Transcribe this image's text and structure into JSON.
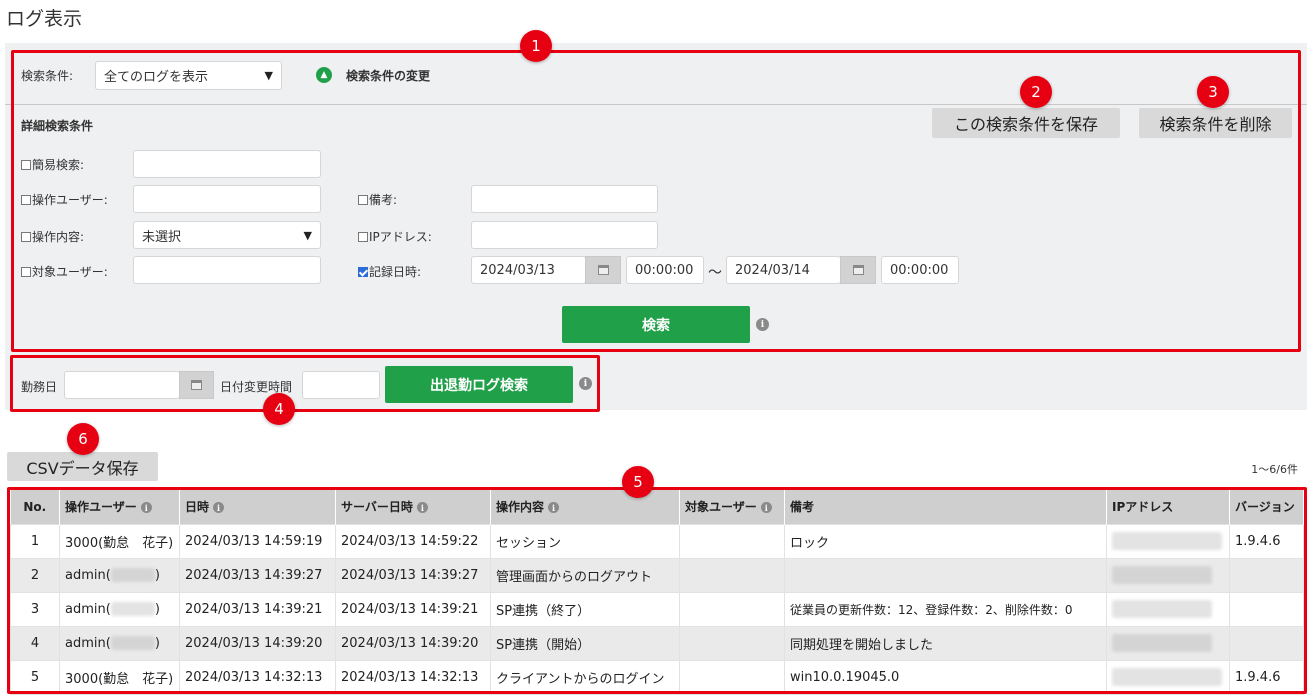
{
  "page": {
    "title": "ログ表示"
  },
  "search": {
    "condition_label": "検索条件:",
    "condition_value": "全てのログを表示",
    "change_label": "検索条件の変更",
    "detail_header": "詳細検索条件",
    "save_button": "この検索条件を保存",
    "delete_button": "検索条件を削除",
    "simple_label": "簡易検索:",
    "user_label": "操作ユーザー:",
    "operation_label": "操作内容:",
    "operation_value": "未選択",
    "target_label": "対象ユーザー:",
    "note_label": "備考:",
    "ip_label": "IPアドレス:",
    "recorded_label": "記録日時:",
    "date_from": "2024/03/13",
    "time_from": "00:00:00",
    "tilde": "～",
    "date_to": "2024/03/14",
    "time_to": "00:00:00",
    "search_button": "検索"
  },
  "attendance": {
    "workday_label": "勤務日",
    "date_change_label": "日付変更時間",
    "search_button": "出退勤ログ検索"
  },
  "csv_button": "CSVデータ保存",
  "result_count": "1～6/6件",
  "markers": [
    "1",
    "2",
    "3",
    "4",
    "5",
    "6"
  ],
  "table": {
    "headers": [
      "No.",
      "操作ユーザー",
      "日時",
      "サーバー日時",
      "操作内容",
      "対象ユーザー",
      "備考",
      "IPアドレス",
      "バージョン"
    ],
    "rows": [
      {
        "no": "1",
        "user": "3000(勤怠　花子)",
        "datetime": "2024/03/13 14:59:19",
        "server": "2024/03/13 14:59:22",
        "operation": "セッション",
        "target": "",
        "note": "ロック",
        "version": "1.9.4.6"
      },
      {
        "no": "2",
        "user": "admin(",
        "datetime": "2024/03/13 14:39:27",
        "server": "2024/03/13 14:39:27",
        "operation": "管理画面からのログアウト",
        "target": "",
        "note": "",
        "version": ""
      },
      {
        "no": "3",
        "user": "admin(",
        "datetime": "2024/03/13 14:39:21",
        "server": "2024/03/13 14:39:21",
        "operation": "SP連携（終了）",
        "target": "",
        "note": "従業員の更新件数：12、登録件数：2、削除件数：0",
        "version": ""
      },
      {
        "no": "4",
        "user": "admin(",
        "datetime": "2024/03/13 14:39:20",
        "server": "2024/03/13 14:39:20",
        "operation": "SP連携（開始）",
        "target": "",
        "note": "同期処理を開始しました",
        "version": ""
      },
      {
        "no": "5",
        "user": "3000(勤怠　花子)",
        "datetime": "2024/03/13 14:32:13",
        "server": "2024/03/13 14:32:13",
        "operation": "クライアントからのログイン",
        "target": "",
        "note": "win10.0.19045.0",
        "version": "1.9.4.6"
      }
    ],
    "admin_close": ")"
  }
}
